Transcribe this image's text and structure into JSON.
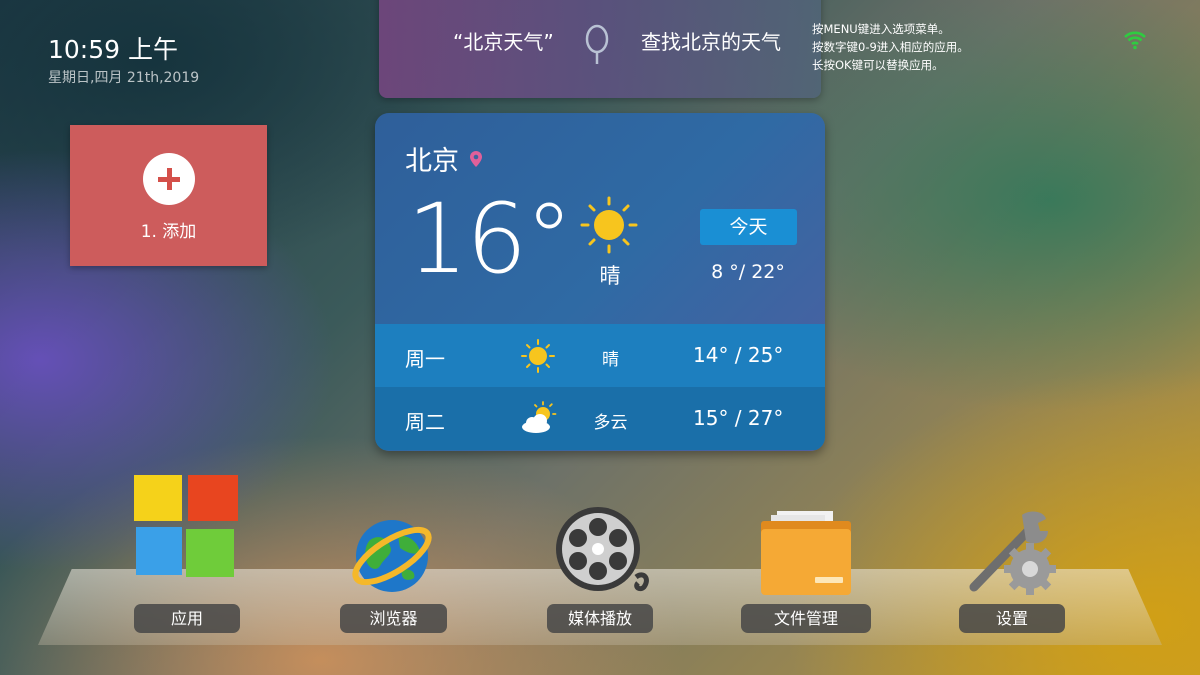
{
  "clock": {
    "time": "10:59 上午",
    "date": "星期日,四月 21th,2019"
  },
  "voice": {
    "query": "“北京天气”",
    "answer": "查找北京的天气",
    "mic_icon": "microphone-icon"
  },
  "hints": [
    "按MENU键进入选项菜单。",
    "按数字键0-9进入相应的应用。",
    "长按OK键可以替换应用。"
  ],
  "status": {
    "wifi_icon": "wifi-icon",
    "wifi_color": "#2ecc40"
  },
  "add_tile": {
    "label": "1. 添加",
    "color": "#cd5c5c"
  },
  "weather": {
    "city": "北京",
    "temperature": "16°",
    "condition": "晴",
    "today_label": "今天",
    "today_range": "8 °/ 22°",
    "forecast": [
      {
        "day": "周一",
        "icon": "sun-icon",
        "condition": "晴",
        "range": "14° / 25°"
      },
      {
        "day": "周二",
        "icon": "partly-cloudy-icon",
        "condition": "多云",
        "range": "15° / 27°"
      }
    ]
  },
  "dock": [
    {
      "label": "应用",
      "icon": "apps-grid-icon"
    },
    {
      "label": "浏览器",
      "icon": "browser-globe-icon"
    },
    {
      "label": "媒体播放",
      "icon": "film-reel-icon"
    },
    {
      "label": "文件管理",
      "icon": "folder-icon"
    },
    {
      "label": "设置",
      "icon": "settings-wrench-icon"
    }
  ]
}
